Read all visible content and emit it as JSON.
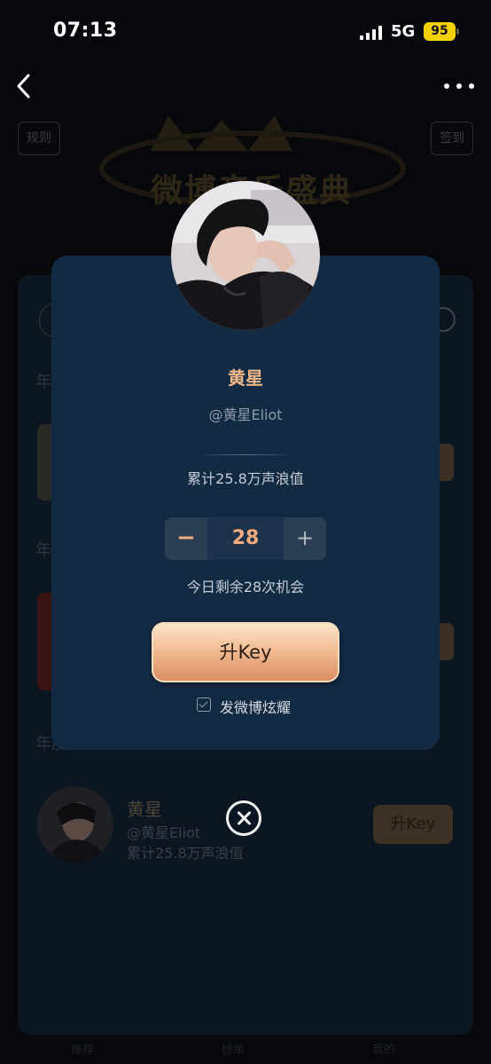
{
  "status_bar": {
    "time": "07:13",
    "network": "5G",
    "battery": "95"
  },
  "background": {
    "rule_button": "规则",
    "signin_button": "签到",
    "banner_title": "微博音乐盛典",
    "year_labels": [
      "年",
      "年",
      "年度"
    ],
    "row": {
      "name": "黄星",
      "handle": "@黄星Eliot",
      "count": "累计25.8万声浪值",
      "button": "升Key"
    },
    "bottom_tabs": [
      "推荐",
      "榜单",
      "我的"
    ]
  },
  "modal": {
    "name": "黄星",
    "handle": "@黄星Eliot",
    "total": "累计25.8万声浪值",
    "stepper": {
      "minus": "−",
      "value": "28",
      "plus": "+"
    },
    "remaining": "今日剩余28次机会",
    "upkey_label": "升Key",
    "share_label": "发微博炫耀",
    "share_checked": true
  },
  "colors": {
    "modal_bg": "#132a43",
    "accent": "#f0b88a",
    "page_bg": "#07080b"
  },
  "icons": {
    "back": "chevron-left-icon",
    "more": "more-dots-icon",
    "close": "close-circle-icon",
    "check": "checkbox-icon"
  }
}
